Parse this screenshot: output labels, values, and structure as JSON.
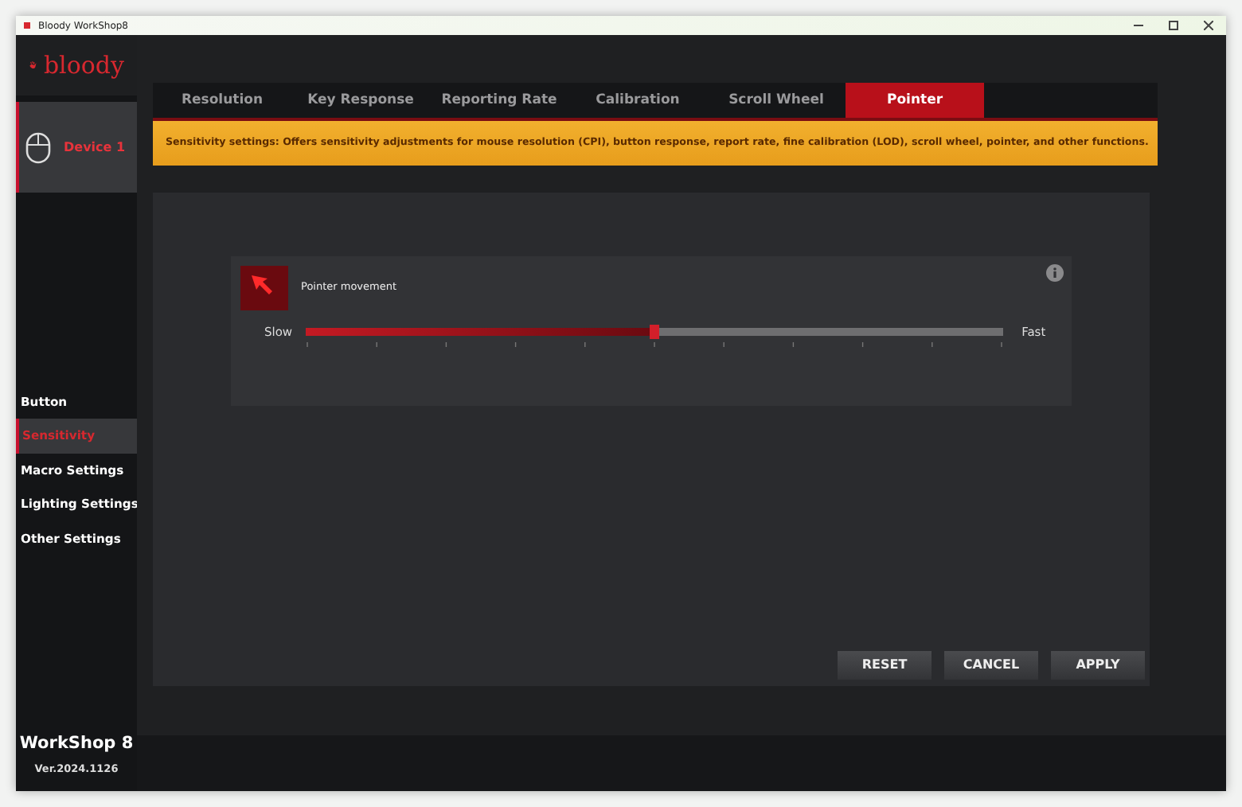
{
  "window": {
    "title": "Bloody WorkShop8"
  },
  "logo": {
    "text": "bloody"
  },
  "device": {
    "label": "Device 1",
    "selected": true
  },
  "sidebar": {
    "items": [
      {
        "label": "Button",
        "selected": false
      },
      {
        "label": "Sensitivity",
        "selected": true
      },
      {
        "label": "Macro Settings",
        "selected": false
      },
      {
        "label": "Lighting Settings",
        "selected": false
      },
      {
        "label": "Other Settings",
        "selected": false
      }
    ]
  },
  "app": {
    "name": "WorkShop 8",
    "version": "Ver.2024.1126"
  },
  "tabs": [
    {
      "label": "Resolution",
      "selected": false
    },
    {
      "label": "Key Response",
      "selected": false
    },
    {
      "label": "Reporting Rate",
      "selected": false
    },
    {
      "label": "Calibration",
      "selected": false
    },
    {
      "label": "Scroll Wheel",
      "selected": false
    },
    {
      "label": "Pointer",
      "selected": true
    }
  ],
  "banner": "Sensitivity settings: Offers sensitivity adjustments for mouse resolution (CPI), button response, report rate, fine calibration (LOD), scroll wheel, pointer, and other functions.",
  "pointer": {
    "title": "Pointer movement",
    "min_label": "Slow",
    "max_label": "Fast",
    "level": 0.5
  },
  "buttons": [
    "RESET",
    "CANCEL",
    "APPLY"
  ]
}
